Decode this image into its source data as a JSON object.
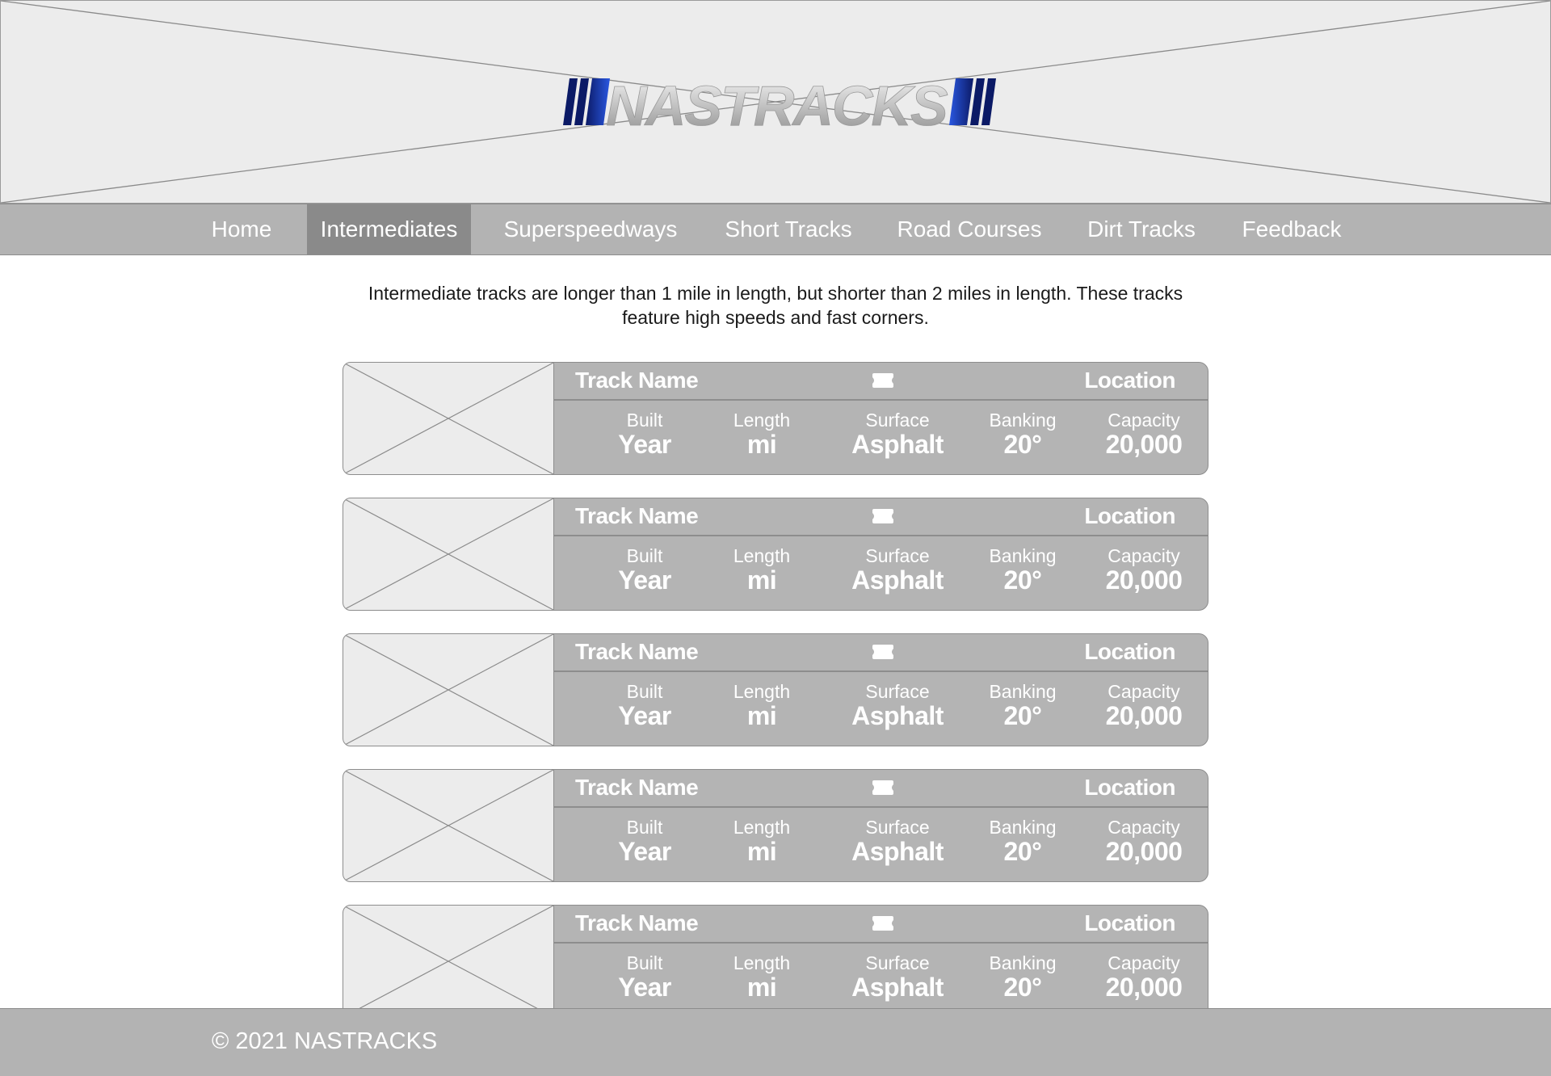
{
  "header": {
    "logo_text": "NASTRACKS"
  },
  "nav": {
    "items": [
      {
        "label": "Home"
      },
      {
        "label": "Intermediates"
      },
      {
        "label": "Superspeedways"
      },
      {
        "label": "Short Tracks"
      },
      {
        "label": "Road Courses"
      },
      {
        "label": "Dirt Tracks"
      },
      {
        "label": "Feedback"
      }
    ],
    "active": "Intermediates"
  },
  "intro": {
    "text": "Intermediate tracks are longer than 1 mile in length, but shorter than 2 miles in length. These tracks feature high speeds and fast corners."
  },
  "stat_labels": {
    "built": "Built",
    "length": "Length",
    "surface": "Surface",
    "banking": "Banking",
    "capacity": "Capacity"
  },
  "tracks": [
    {
      "name": "Track Name",
      "location": "Location",
      "built": "Year",
      "length": "mi",
      "surface": "Asphalt",
      "banking": "20°",
      "capacity": "20,000",
      "icon": "track-oval-icon"
    },
    {
      "name": "Track Name",
      "location": "Location",
      "built": "Year",
      "length": "mi",
      "surface": "Asphalt",
      "banking": "20°",
      "capacity": "20,000",
      "icon": "track-oval-icon"
    },
    {
      "name": "Track Name",
      "location": "Location",
      "built": "Year",
      "length": "mi",
      "surface": "Asphalt",
      "banking": "20°",
      "capacity": "20,000",
      "icon": "track-oval-icon"
    },
    {
      "name": "Track Name",
      "location": "Location",
      "built": "Year",
      "length": "mi",
      "surface": "Asphalt",
      "banking": "20°",
      "capacity": "20,000",
      "icon": "track-oval-icon"
    },
    {
      "name": "Track Name",
      "location": "Location",
      "built": "Year",
      "length": "mi",
      "surface": "Asphalt",
      "banking": "20°",
      "capacity": "20,000",
      "icon": "track-oval-icon"
    }
  ],
  "footer": {
    "text": "© 2021 NASTRACKS"
  },
  "colors": {
    "bar_gray": "#b3b3b3",
    "active_nav": "#8a8a8a",
    "placeholder": "#ececec",
    "logo_blue": "#1c3fb8"
  }
}
